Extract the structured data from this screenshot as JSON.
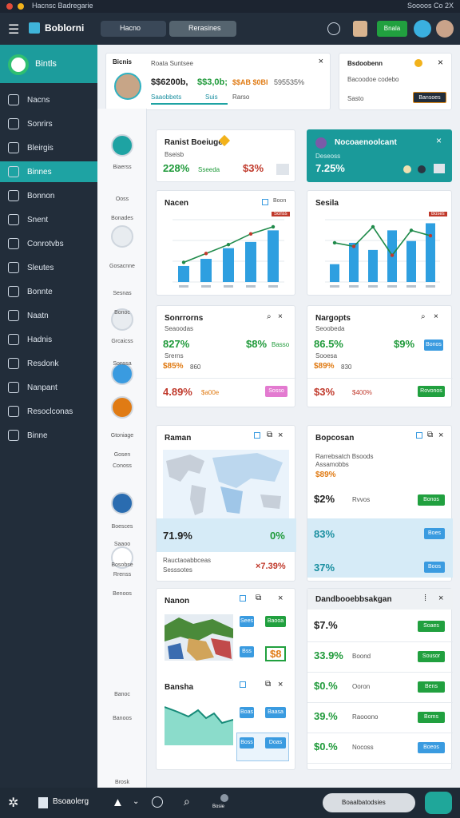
{
  "system_bar": {
    "title": "Hacnsc Badregarie",
    "right": "Soooos Co 2X"
  },
  "topbar": {
    "app_name": "Boblorni",
    "filter_label": "Hacno",
    "search_label": "Rerasines",
    "action_button": "Bnala"
  },
  "sidebar": {
    "brand": "Bintls",
    "items": [
      {
        "label": "Nacns"
      },
      {
        "label": "Sonrirs"
      },
      {
        "label": "Bleirgis"
      },
      {
        "label": "Binnes"
      },
      {
        "label": "Bonnon"
      },
      {
        "label": "Snent"
      },
      {
        "label": "Conrotvbs"
      },
      {
        "label": "Sleutes"
      },
      {
        "label": "Bonnte"
      },
      {
        "label": "Naatn"
      },
      {
        "label": "Hadnis"
      },
      {
        "label": "Resdonk"
      },
      {
        "label": "Nanpant"
      },
      {
        "label": "Resoclconas"
      },
      {
        "label": "Binne"
      }
    ]
  },
  "profile_card": {
    "name": "Bicnis",
    "header": "Roata Suntsee",
    "stat1": "$$6200b,",
    "stat2": "$$3,0b;",
    "stat3": "$$AB $0BI",
    "stat4": "595535%",
    "tab1": "Saaobbets",
    "tab2": "Suis",
    "tab3": "Rarso"
  },
  "notice_card": {
    "title": "Bsdoobenn",
    "subtitle": "Bacoodoe codebo",
    "left": "Sasto",
    "button": "Bansoes"
  },
  "rail": {
    "labels": [
      "Biaerss",
      "Ooss",
      "Bonades",
      "Gosacnne",
      "Sesnas",
      "Bonoc",
      "Grcaicss",
      "Sonssa",
      "Gtoniage",
      "Gosen",
      "Conoss",
      "Boesces",
      "Saaoo",
      "Bosobse",
      "Rrenss",
      "Benoos",
      "Banoc",
      "Banoos",
      "Brosk"
    ]
  },
  "kpi1": {
    "title": "Ranist Boeiuge",
    "sub": "Bseisb",
    "value": "228%",
    "label": "Sseeda",
    "value2": "$3%"
  },
  "kpi2": {
    "title": "Nocoaenoolcant",
    "sub": "Deseoss",
    "value": "7.25%"
  },
  "chart1": {
    "title": "Nacen",
    "tag": "Boon",
    "label": "Sonss"
  },
  "chart2": {
    "title": "Sesila",
    "label": "Boses"
  },
  "stats_left": {
    "title": "Sonrrorns",
    "sub": "Seaoodas",
    "v1": "827%",
    "v1b": "$8%",
    "v1c": "Basso",
    "v2": "Srerns",
    "v3": "$85%",
    "v3b": "860",
    "v4": "4.89%",
    "v4b": "$a00e",
    "btn": "Sosso"
  },
  "stats_right": {
    "title": "Nargopts",
    "sub": "Seoobeda",
    "v1": "86.5%",
    "v1b": "$9%",
    "v1c": "Bonos",
    "v2": "Sooesa",
    "v3": "$89%",
    "v3b": "830",
    "v4": "$3%",
    "v4b": "$400%",
    "btn": "Rovonos"
  },
  "map_card": {
    "title": "Raman",
    "v1": "71.9%",
    "v2": "0%",
    "foot1": "Rauctaoabbceas",
    "foot2": "Sesssotes",
    "v3": "×7.39%"
  },
  "list_card": {
    "title": "Bopcosan",
    "sub1": "Rarrebsatch Bsoods",
    "sub2": "Assamobbs",
    "v0": "$89%",
    "v1": "$2%",
    "v1b": "Rvvos",
    "b1": "Bonos",
    "v2": "83%",
    "b2": "Boes",
    "v3": "37%",
    "b3": "Boos"
  },
  "lower_left": {
    "title1": "Nanon",
    "b1": "Sees",
    "b2": "Baooa",
    "b3": "Bss",
    "v": "$8",
    "title2": "Bansha",
    "b4": "Boas",
    "b5": "Baasa",
    "b6": "Boss",
    "b7": "Doas"
  },
  "lower_right": {
    "title": "Dandbooebbsakgan",
    "rows": [
      {
        "v": "$7.%",
        "l": "",
        "b": "Soaes"
      },
      {
        "v": "33.9%",
        "l": "Boond",
        "b": "Sousor"
      },
      {
        "v": "$0.%",
        "l": "Ooron",
        "b": "Bens"
      },
      {
        "v": "39.%",
        "l": "Raooono",
        "b": "Boms"
      },
      {
        "v": "$0.%",
        "l": "Nocoss",
        "b": "Boeos"
      }
    ]
  },
  "bottombar": {
    "label": "Bsoaolerg",
    "center": "Bosie",
    "search_label": "Boaalbatodsies"
  },
  "chart_data": [
    {
      "type": "bar",
      "name": "chart1",
      "values": [
        18,
        26,
        38,
        45,
        58
      ],
      "line": [
        22,
        32,
        42,
        54,
        62
      ],
      "ylim": [
        0,
        70
      ]
    },
    {
      "type": "bar",
      "name": "chart2",
      "values": [
        20,
        44,
        36,
        58,
        46,
        66
      ],
      "line": [
        44,
        40,
        62,
        30,
        58,
        52
      ],
      "ylim": [
        0,
        70
      ]
    }
  ]
}
